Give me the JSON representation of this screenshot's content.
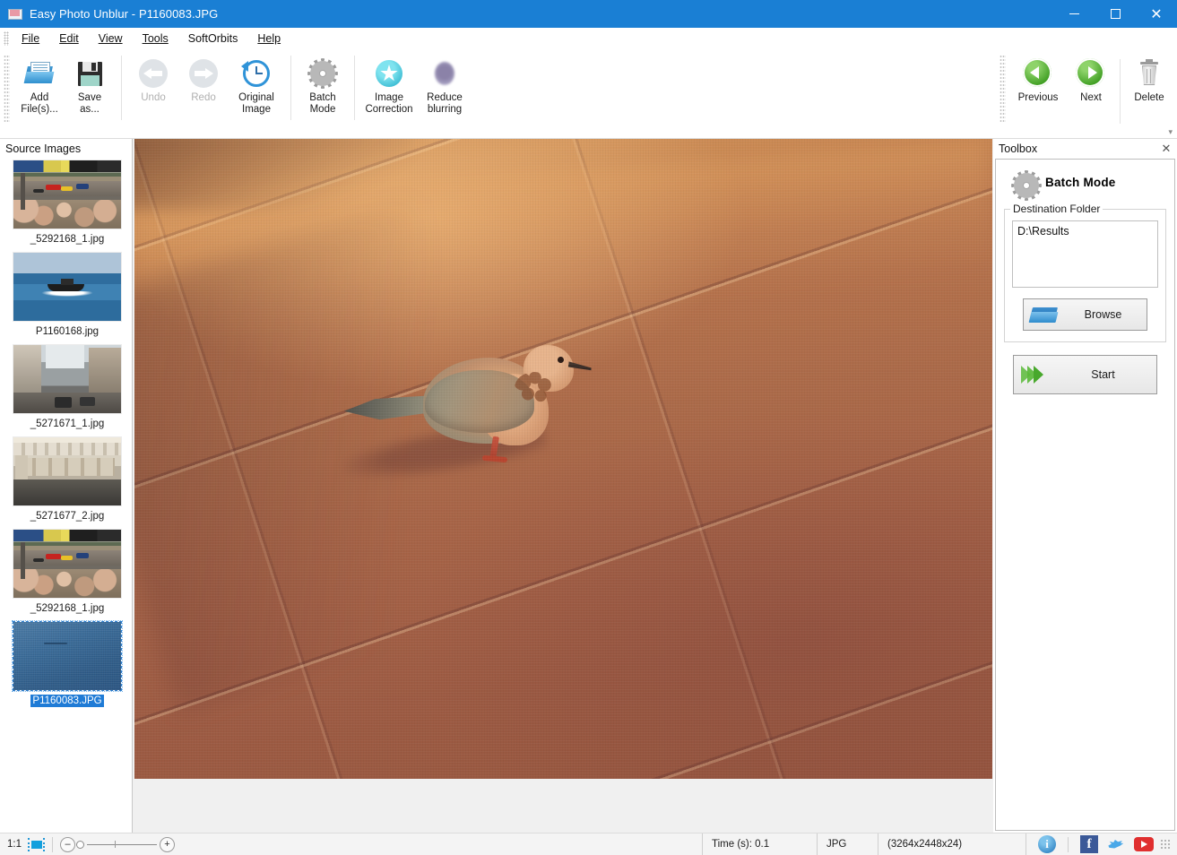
{
  "window": {
    "title": "Easy Photo Unblur - P1160083.JPG",
    "app_icon": "photo-app-icon",
    "minimize_label": "Minimize",
    "maximize_label": "Maximize",
    "close_label": "Close",
    "accent_color": "#1a7fd4"
  },
  "menubar": {
    "items": [
      {
        "label": "File"
      },
      {
        "label": "Edit"
      },
      {
        "label": "View"
      },
      {
        "label": "Tools"
      },
      {
        "label": "SoftOrbits"
      },
      {
        "label": "Help"
      }
    ]
  },
  "toolbar": {
    "buttons": [
      {
        "label": "Add\nFile(s)...",
        "icon": "add-files-icon",
        "disabled": false
      },
      {
        "label": "Save\nas...",
        "icon": "save-as-icon",
        "disabled": false
      },
      {
        "label": "Undo",
        "icon": "undo-icon",
        "disabled": true
      },
      {
        "label": "Redo",
        "icon": "redo-icon",
        "disabled": true
      },
      {
        "label": "Original\nImage",
        "icon": "original-image-icon",
        "disabled": false
      },
      {
        "label": "Batch\nMode",
        "icon": "batch-mode-gear-icon",
        "disabled": false
      },
      {
        "label": "Image\nCorrection",
        "icon": "image-correction-icon",
        "disabled": false
      },
      {
        "label": "Reduce\nblurring",
        "icon": "reduce-blurring-icon",
        "disabled": false
      }
    ],
    "right_buttons": [
      {
        "label": "Previous",
        "icon": "previous-icon"
      },
      {
        "label": "Next",
        "icon": "next-icon"
      },
      {
        "label": "Delete",
        "icon": "delete-trash-icon"
      }
    ],
    "expand_glyph": "▾"
  },
  "sidebar": {
    "header": "Source Images",
    "items": [
      {
        "filename": "_5292168_1.jpg",
        "thumb": "race-cars",
        "selected": false
      },
      {
        "filename": "P1160168.jpg",
        "thumb": "boat-sea",
        "selected": false
      },
      {
        "filename": "_5271671_1.jpg",
        "thumb": "city-street",
        "selected": false
      },
      {
        "filename": "_5271677_2.jpg",
        "thumb": "stone-arch",
        "selected": false
      },
      {
        "filename": "_5292168_1.jpg",
        "thumb": "race-cars",
        "selected": false
      },
      {
        "filename": "P1160083.JPG",
        "thumb": "blue-sea",
        "selected": true
      }
    ]
  },
  "canvas": {
    "image_name": "P1160083.JPG",
    "subject": "laughing-dove-on-terracotta-paving"
  },
  "toolbox": {
    "title": "Toolbox",
    "close_glyph": "✕",
    "panel_title": "Batch Mode",
    "panel_icon": "gear-icon",
    "group_legend": "Destination Folder",
    "destination_path": "D:\\Results",
    "browse_label": "Browse",
    "browse_icon": "folder-icon",
    "start_label": "Start",
    "start_icon": "green-arrow-icon"
  },
  "statusbar": {
    "zoom_ratio": "1:1",
    "fit_icon": "fit-to-window-icon",
    "zoom_out_glyph": "–",
    "zoom_in_glyph": "+",
    "time": "Time (s): 0.1",
    "format": "JPG",
    "dimensions": "(3264x2448x24)",
    "social": [
      {
        "name": "info-icon",
        "glyph": "i"
      },
      {
        "name": "facebook-icon",
        "glyph": "f"
      },
      {
        "name": "twitter-icon",
        "glyph": ""
      },
      {
        "name": "youtube-icon",
        "glyph": ""
      }
    ]
  }
}
